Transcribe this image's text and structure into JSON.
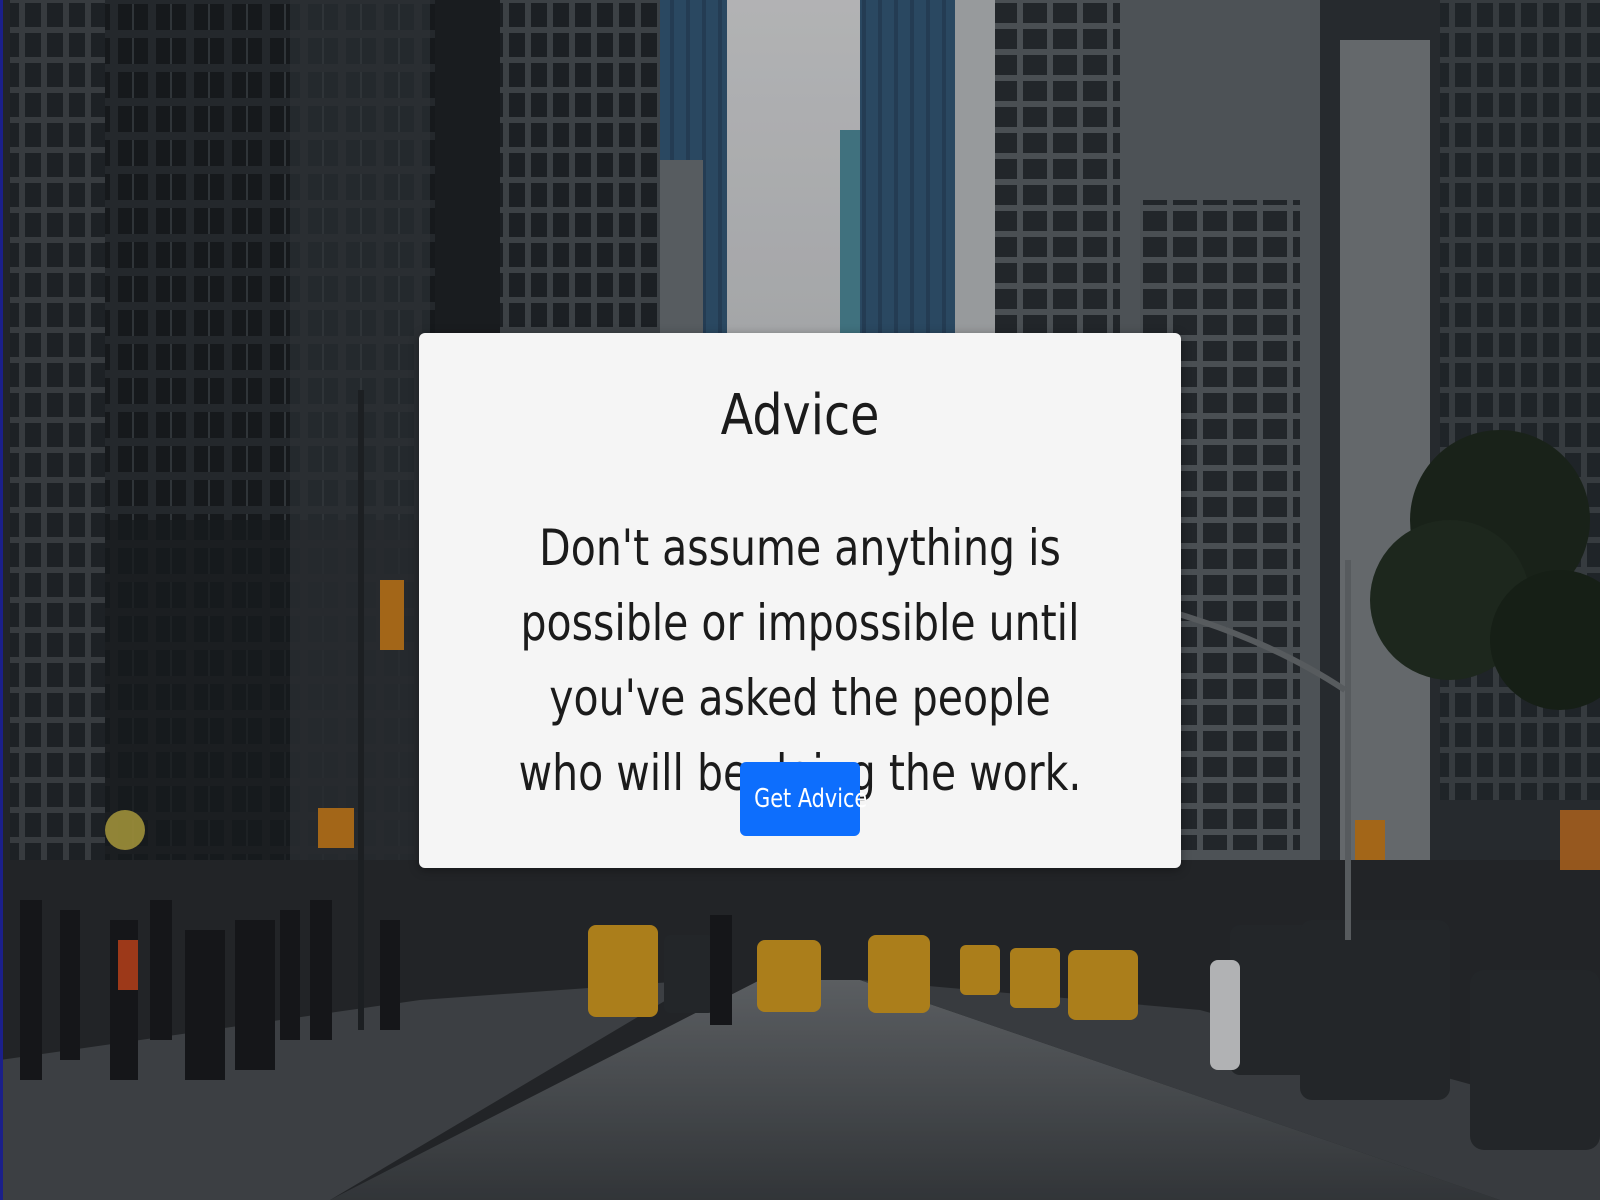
{
  "background": {
    "description_icon": "city-street-photo",
    "overlay_color": "#000000"
  },
  "card": {
    "title": "Advice",
    "quote": "Don't assume anything is possible or impossible until you've asked the people who will be doing the work.",
    "button_label": "Get Advice"
  },
  "colors": {
    "card_bg": "#f5f5f5",
    "text": "#1b1b1b",
    "button_bg": "#0d6efd",
    "button_text": "#ffffff"
  }
}
